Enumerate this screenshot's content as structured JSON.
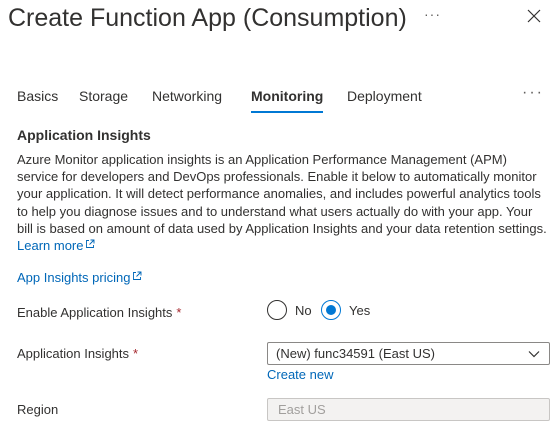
{
  "header": {
    "title": "Create Function App (Consumption)",
    "more_label": "···",
    "close_icon": "close-icon"
  },
  "tabs": [
    {
      "label": "Basics",
      "active": false
    },
    {
      "label": "Storage",
      "active": false
    },
    {
      "label": "Networking",
      "active": false
    },
    {
      "label": "Monitoring",
      "active": true
    },
    {
      "label": "Deployment",
      "active": false
    }
  ],
  "tabs_more_label": "···",
  "section": {
    "heading": "Application Insights",
    "description": "Azure Monitor application insights is an Application Performance Management (APM) service for developers and DevOps professionals. Enable it below to automatically monitor your application. It will detect performance anomalies, and includes powerful analytics tools to help you diagnose issues and to understand what users actually do with your app. Your bill is based on amount of data used by Application Insights and your data retention settings.",
    "learn_more": "Learn more",
    "pricing_link": "App Insights pricing"
  },
  "form": {
    "enable_label": "Enable Application Insights",
    "required_mark": "*",
    "enable_options": [
      {
        "label": "No",
        "checked": false
      },
      {
        "label": "Yes",
        "checked": true
      }
    ],
    "insights_label": "Application Insights",
    "insights_value": "(New) func34591 (East US)",
    "create_new": "Create new",
    "region_label": "Region",
    "region_value": "East US"
  },
  "colors": {
    "accent": "#0078d4",
    "link": "#0067b8",
    "required": "#a4262c",
    "text": "#323130"
  }
}
